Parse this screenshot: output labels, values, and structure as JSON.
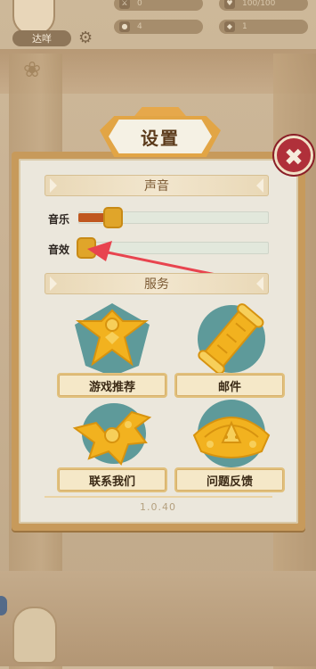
{
  "hud": {
    "player_name": "达咩",
    "stats": [
      {
        "icon": "sword-icon",
        "value": "0"
      },
      {
        "icon": "heart-icon",
        "value": "100/100"
      },
      {
        "icon": "coin-icon",
        "value": "4"
      },
      {
        "icon": "gem-icon",
        "value": "1"
      }
    ]
  },
  "dialog": {
    "title": "设置",
    "sections": {
      "sound": "声音",
      "service": "服务"
    },
    "sliders": [
      {
        "label": "音乐",
        "level": 0.18
      },
      {
        "label": "音效",
        "level": 0.0
      }
    ],
    "services": [
      {
        "label": "游戏推荐",
        "icon": "kite-icon"
      },
      {
        "label": "邮件",
        "icon": "scroll-icon"
      },
      {
        "label": "联系我们",
        "icon": "bird-icon"
      },
      {
        "label": "问题反馈",
        "icon": "crown-icon"
      }
    ],
    "version": "1.0.40"
  },
  "colors": {
    "accent": "#e0a52a",
    "music_fill": "#c0571f",
    "close": "#b0303a",
    "annotation_arrow": "#e8444f",
    "icon_teal": "#5e9a9a",
    "icon_gold": "#f2b21f"
  }
}
